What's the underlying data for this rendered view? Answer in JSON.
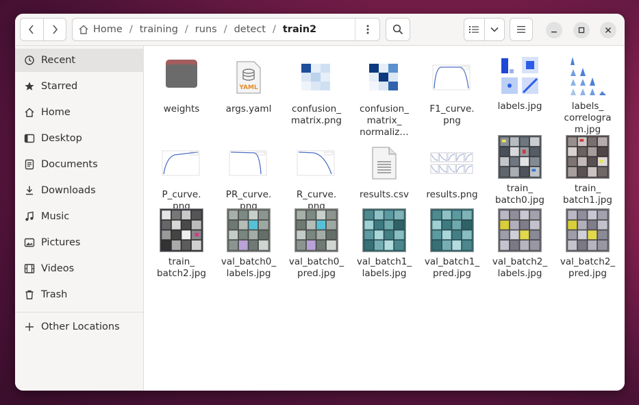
{
  "nav": {
    "back_icon": "chevron-left-icon",
    "forward_icon": "chevron-right-icon"
  },
  "path": {
    "home_icon": "home-icon",
    "crumbs": [
      "Home",
      "training",
      "runs",
      "detect"
    ],
    "current": "train2",
    "separator": "/",
    "menu_icon": "vertical-dots-icon"
  },
  "toolbar": {
    "search_icon": "search-icon",
    "view_icon": "list-view-icon",
    "view_dropdown_icon": "chevron-down-icon",
    "menu_icon": "hamburger-menu-icon"
  },
  "window_controls": {
    "minimize": "minimize-icon",
    "maximize": "maximize-icon",
    "close": "close-icon"
  },
  "sidebar": {
    "items": [
      {
        "label": "Recent",
        "icon": "clock-icon",
        "active": true
      },
      {
        "label": "Starred",
        "icon": "star-icon"
      },
      {
        "label": "Home",
        "icon": "home-icon"
      },
      {
        "label": "Desktop",
        "icon": "desktop-icon"
      },
      {
        "label": "Documents",
        "icon": "document-icon"
      },
      {
        "label": "Downloads",
        "icon": "download-icon"
      },
      {
        "label": "Music",
        "icon": "music-icon"
      },
      {
        "label": "Pictures",
        "icon": "picture-icon"
      },
      {
        "label": "Videos",
        "icon": "video-icon"
      },
      {
        "label": "Trash",
        "icon": "trash-icon"
      }
    ],
    "other": {
      "label": "Other Locations",
      "icon": "plus-icon"
    }
  },
  "files": [
    {
      "name": "weights",
      "kind": "folder"
    },
    {
      "name": "args.yaml",
      "kind": "yaml"
    },
    {
      "name": "confusion_\nmatrix.png",
      "kind": "matrix"
    },
    {
      "name": "confusion_\nmatrix_\nnormaliz…",
      "kind": "matrix-dark"
    },
    {
      "name": "F1_curve.\npng",
      "kind": "curve"
    },
    {
      "name": "labels.jpg",
      "kind": "labels"
    },
    {
      "name": "labels_\ncorrelogra\nm.jpg",
      "kind": "correlogram"
    },
    {
      "name": "P_curve.\npng",
      "kind": "curve-rise"
    },
    {
      "name": "PR_curve.\npng",
      "kind": "curve-fall"
    },
    {
      "name": "R_curve.\npng",
      "kind": "curve-fall"
    },
    {
      "name": "results.csv",
      "kind": "csv"
    },
    {
      "name": "results.png",
      "kind": "results"
    },
    {
      "name": "train_\nbatch0.jpg",
      "kind": "photo"
    },
    {
      "name": "train_\nbatch1.jpg",
      "kind": "photo"
    },
    {
      "name": "train_\nbatch2.jpg",
      "kind": "photo"
    },
    {
      "name": "val_batch0_\nlabels.jpg",
      "kind": "photo"
    },
    {
      "name": "val_batch0_\npred.jpg",
      "kind": "photo"
    },
    {
      "name": "val_batch1_\nlabels.jpg",
      "kind": "photo-teal"
    },
    {
      "name": "val_batch1_\npred.jpg",
      "kind": "photo-teal"
    },
    {
      "name": "val_batch2_\nlabels.jpg",
      "kind": "photo-yellow"
    },
    {
      "name": "val_batch2_\npred.jpg",
      "kind": "photo-yellow"
    }
  ],
  "colors": {
    "folder": "#6b6b6b",
    "accent_matrix": "#1f4e9c",
    "bg": "#ffffff",
    "sidebar": "#f6f5f4"
  }
}
